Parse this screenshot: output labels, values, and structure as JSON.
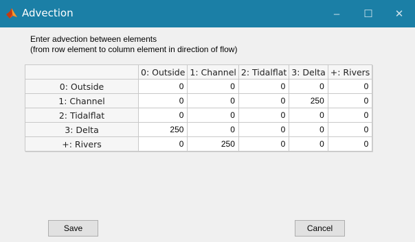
{
  "window": {
    "title": "Advection",
    "minimize_glyph": "–",
    "maximize_glyph": "☐",
    "close_glyph": "✕"
  },
  "instructions": {
    "line1": "Enter advection between elements",
    "line2": "(from row element to column element in direction of flow)"
  },
  "table": {
    "columns": [
      "0: Outside",
      "1: Channel",
      "2: Tidalflat",
      "3: Delta",
      "+: Rivers"
    ],
    "rows": [
      {
        "label": "0: Outside",
        "values": [
          "0",
          "0",
          "0",
          "0",
          "0"
        ]
      },
      {
        "label": "1: Channel",
        "values": [
          "0",
          "0",
          "0",
          "250",
          "0"
        ]
      },
      {
        "label": "2: Tidalflat",
        "values": [
          "0",
          "0",
          "0",
          "0",
          "0"
        ]
      },
      {
        "label": "3: Delta",
        "values": [
          "250",
          "0",
          "0",
          "0",
          "0"
        ]
      },
      {
        "label": "+: Rivers",
        "values": [
          "0",
          "250",
          "0",
          "0",
          "0"
        ]
      }
    ]
  },
  "buttons": {
    "save": "Save",
    "cancel": "Cancel"
  },
  "colors": {
    "titlebar": "#1b7fa6",
    "background": "#f0f0f0"
  },
  "icons": {
    "app": "matlab-icon"
  }
}
